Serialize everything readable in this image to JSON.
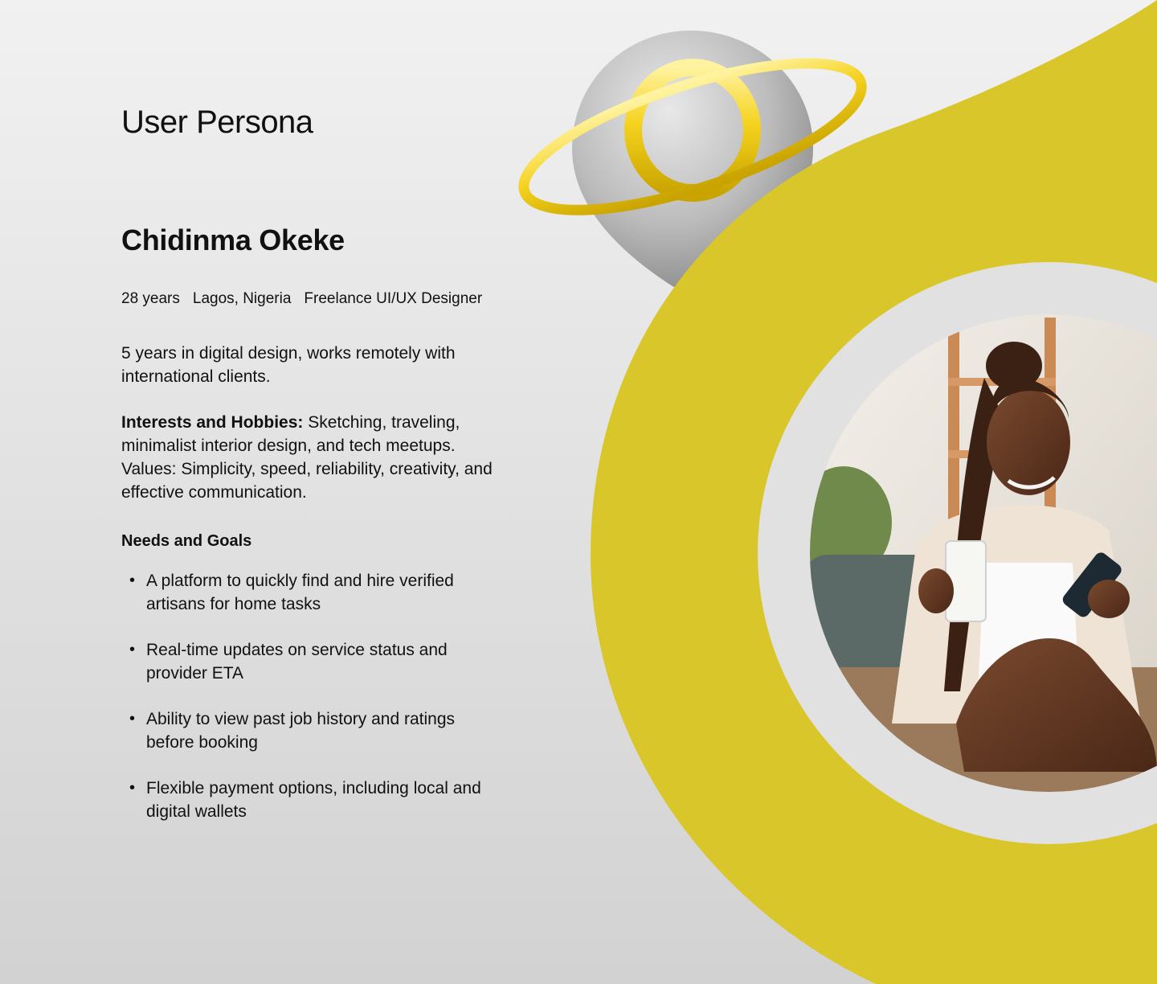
{
  "page": {
    "title": "User Persona"
  },
  "persona": {
    "name": "Chidinma Okeke",
    "meta": [
      "28 years",
      "Lagos, Nigeria",
      "Freelance UI/UX Designer"
    ],
    "summary": "5 years in digital design, works remotely with international clients.",
    "interests_label": "Interests and Hobbies:",
    "interests_text": " Sketching, traveling, minimalist interior design, and tech meetups. Values: Simplicity, speed, reliability, creativity, and effective communication.",
    "goals_heading": "Needs and Goals",
    "goals": [
      "A platform to quickly find and hire verified artisans for home tasks",
      "Real-time updates on service status and provider ETA",
      "Ability to view past job history and ratings before booking",
      "Flexible payment options, including local and digital wallets"
    ]
  },
  "colors": {
    "accent": "#d9c62a",
    "ring": "#f5d422",
    "background": "#e4e4e4",
    "text": "#111111"
  },
  "icons": {
    "location_pin": "map-pin-icon"
  }
}
